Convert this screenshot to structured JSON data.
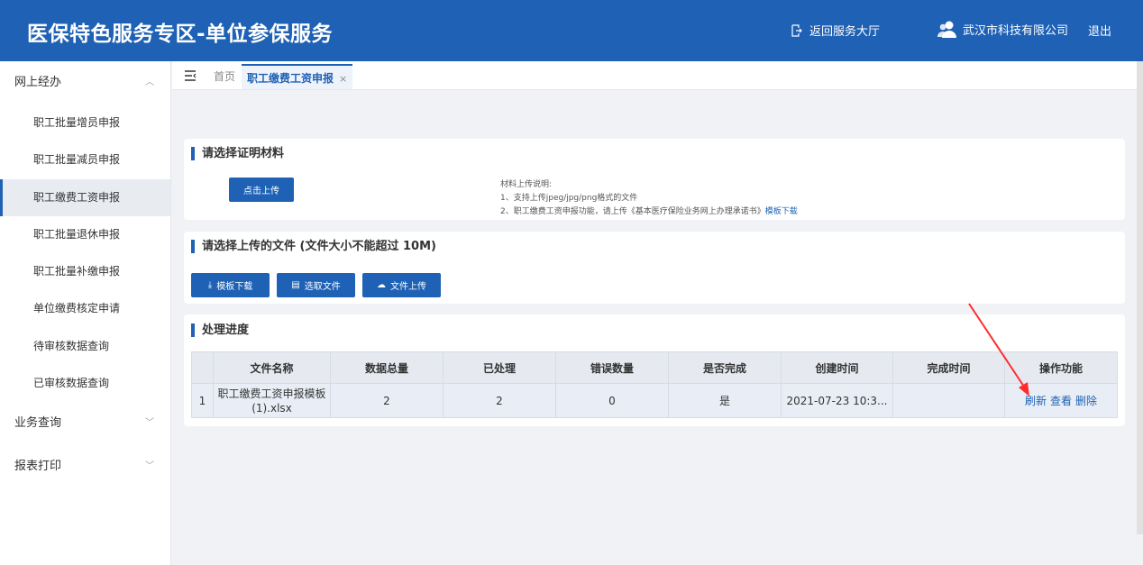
{
  "header": {
    "title": "医保特色服务专区-单位参保服务",
    "back_label": "返回服务大厅",
    "company": "武汉市科技有限公司",
    "logout": "退出"
  },
  "sidebar": {
    "groups": [
      {
        "label": "网上经办",
        "items": [
          "职工批量增员申报",
          "职工批量减员申报",
          "职工缴费工资申报",
          "职工批量退休申报",
          "职工批量补缴申报",
          "单位缴费核定申请",
          "待审核数据查询",
          "已审核数据查询"
        ]
      },
      {
        "label": "业务查询"
      },
      {
        "label": "报表打印"
      }
    ],
    "active": "职工缴费工资申报"
  },
  "tabs": {
    "home": "首页",
    "current": "职工缴费工资申报",
    "close": "×"
  },
  "section1": {
    "title": "请选择证明材料",
    "upload_button": "点击上传",
    "notes_heading": "材料上传说明:",
    "note1": "1、支持上传jpeg/jpg/png格式的文件",
    "note2": "2、职工缴费工资申报功能，请上传《基本医疗保险业务网上办理承诺书》",
    "note2_link": "模板下载"
  },
  "section2": {
    "title": "请选择上传的文件 (文件大小不能超过 10M)",
    "template_button": "模板下载",
    "select_button": "选取文件",
    "upload_button": "文件上传"
  },
  "section3": {
    "title": "处理进度",
    "columns": [
      "",
      "文件名称",
      "数据总量",
      "已处理",
      "错误数量",
      "是否完成",
      "创建时间",
      "完成时间",
      "操作功能"
    ],
    "rows": [
      {
        "index": "1",
        "file": "职工缴费工资申报模板 (1).xlsx",
        "total": "2",
        "processed": "2",
        "errors": "0",
        "done": "是",
        "created": "2021-07-23 10:3...",
        "finished": "",
        "ops": [
          "刷新",
          "查看",
          "删除"
        ]
      }
    ]
  },
  "colors": {
    "primary": "#1f61b4",
    "annotation": "#ff2d2d"
  }
}
